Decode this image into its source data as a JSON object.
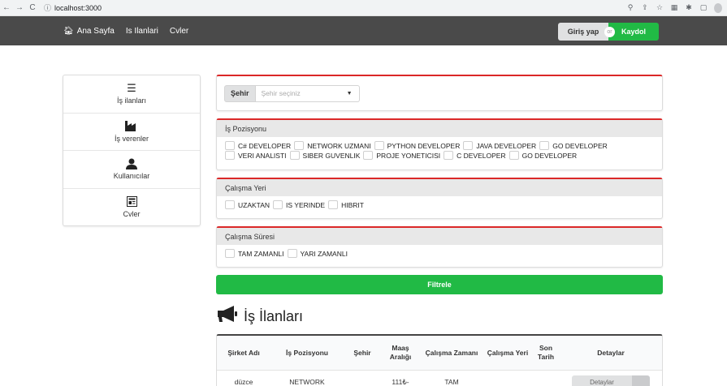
{
  "browser": {
    "url": "localhost:3000",
    "back": "←",
    "forward": "→",
    "reload": "C",
    "info": "ⓘ",
    "icons": [
      "⚲",
      "⇪",
      "☆",
      "▦",
      "✱",
      "▢"
    ]
  },
  "navbar": {
    "items": [
      {
        "label": "Ana Sayfa",
        "icon": "home-icon"
      },
      {
        "label": "Is Ilanlari"
      },
      {
        "label": "Cvler"
      }
    ],
    "login": "Giriş yap",
    "or": "or",
    "signup": "Kaydol",
    "colors": {
      "bar": "#4a4a4a",
      "signup": "#21ba45",
      "login": "#e0e1e2"
    }
  },
  "sidebar": {
    "items": [
      {
        "label": "İş ilanları",
        "icon": "list-icon"
      },
      {
        "label": "İş verenler",
        "icon": "factory-icon"
      },
      {
        "label": "Kullanıcılar",
        "icon": "user-icon"
      },
      {
        "label": "Cvler",
        "icon": "newspaper-icon"
      }
    ]
  },
  "filters": {
    "city": {
      "label": "Şehir",
      "placeholder": "Şehir seçiniz"
    },
    "position": {
      "title": "İş Pozisyonu",
      "row1": [
        "C# DEVELOPER",
        "NETWORK UZMANI",
        "PYTHON DEVELOPER",
        "JAVA DEVELOPER",
        "GO DEVELOPER"
      ],
      "row2": [
        "VERI ANALISTI",
        "SIBER GUVENLIK",
        "PROJE YONETICISI",
        "C DEVELOPER",
        "GO DEVELOPER"
      ]
    },
    "workplace": {
      "title": "Çalışma Yeri",
      "options": [
        "UZAKTAN",
        "IS YERINDE",
        "HIBRIT"
      ]
    },
    "duration": {
      "title": "Çalışma Süresi",
      "options": [
        "TAM ZAMANLI",
        "YARI ZAMANLI"
      ]
    },
    "button": "Filtrele",
    "accent": "#db2828"
  },
  "listing": {
    "title": "İş İlanları",
    "columns": [
      "Şirket Adı",
      "İş Pozisyonu",
      "Şehir",
      "Maaş Aralığı",
      "Çalışma Zamanı",
      "Çalışma Yeri",
      "Son Tarih",
      "Detaylar"
    ],
    "rows": [
      {
        "company": "düzce",
        "position": "NETWORK",
        "city": "",
        "salary": "111₺-",
        "time": "TAM",
        "place": "",
        "deadline": "",
        "details": "Detaylar"
      }
    ]
  }
}
